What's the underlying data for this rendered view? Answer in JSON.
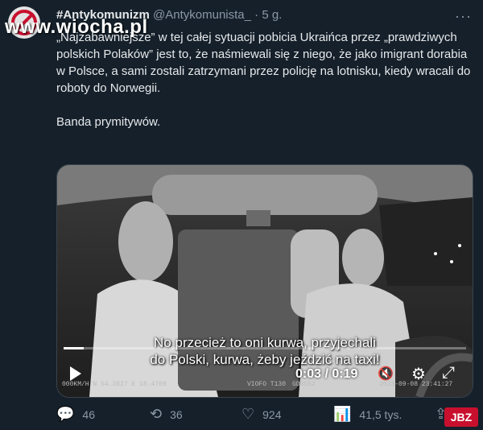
{
  "tweet": {
    "author_name": "#Antykomunizm",
    "handle": "@Antykomunista_",
    "separator": "·",
    "time": "5 g.",
    "more": "···",
    "paragraph1": "„Najzabawniejsze” w tej całej sytuacji pobicia Ukraińca przez „prawdziwych polskich Polaków” jest to, że naśmiewali się z niego, że jako imigrant dorabia w Polsce, a sami zostali zatrzymani przez policję na lotnisku, kiedy wracali do roboty do Norwegii.",
    "paragraph2": "Banda prymitywów."
  },
  "watermark": "www.wiocha.pl",
  "video": {
    "subtitle_line1": "No przecież to oni kurwa, przyjechali",
    "subtitle_line2": "do Polski, kurwa, żeby jeździć na taxi!",
    "time_readout": "0:03 / 0:19",
    "progress_fraction": 0.05,
    "overlay_left": "000KM/H  N 54.3827  E 18.4709",
    "overlay_mid": "VIOFO T130",
    "overlay_gps": "GD6G52",
    "overlay_date": "2023-09-08  23:41:27"
  },
  "actions": {
    "replies": "46",
    "retweets": "36",
    "likes": "924",
    "views": "41,5 tys."
  },
  "icons": {
    "reply": "reply-icon",
    "retweet": "retweet-icon",
    "like": "heart-icon",
    "views": "views-icon",
    "share": "share-icon"
  },
  "logo": "JBZ"
}
